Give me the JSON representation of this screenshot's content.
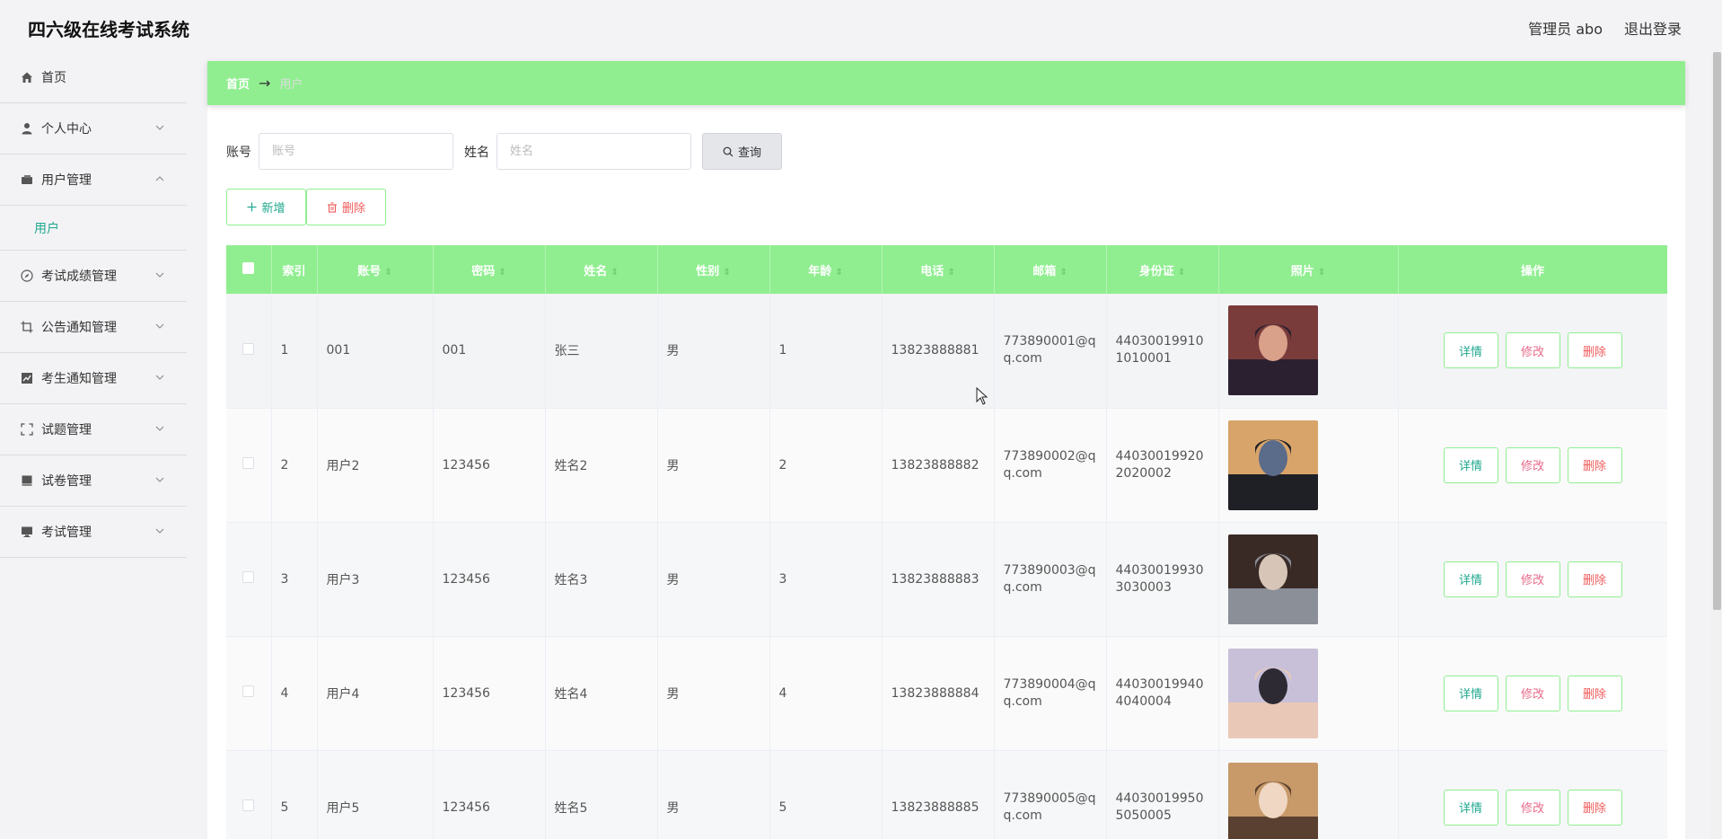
{
  "header": {
    "app_title": "四六级在线考试系统",
    "user_label": "管理员 abo",
    "logout_label": "退出登录"
  },
  "sidebar": {
    "items": [
      {
        "label": "首页",
        "icon": "home-icon"
      },
      {
        "label": "个人中心",
        "icon": "user-icon"
      },
      {
        "label": "用户管理",
        "icon": "wallet-icon",
        "expanded": true
      },
      {
        "label": "考试成绩管理",
        "icon": "compass-icon"
      },
      {
        "label": "公告通知管理",
        "icon": "crop-icon"
      },
      {
        "label": "考生通知管理",
        "icon": "chart-icon"
      },
      {
        "label": "试题管理",
        "icon": "fullscreen-icon"
      },
      {
        "label": "试卷管理",
        "icon": "notebook-icon"
      },
      {
        "label": "考试管理",
        "icon": "monitor-icon"
      }
    ],
    "submenu_active": "用户"
  },
  "breadcrumb": {
    "home": "首页",
    "arrow": "→",
    "current": "用户"
  },
  "search": {
    "account_label": "账号",
    "account_placeholder": "账号",
    "account_value": "",
    "name_label": "姓名",
    "name_placeholder": "姓名",
    "name_value": "",
    "query_label": "查询"
  },
  "actions": {
    "add_label": "新增",
    "delete_label": "删除"
  },
  "table": {
    "columns": [
      "索引",
      "账号",
      "密码",
      "姓名",
      "性别",
      "年龄",
      "电话",
      "邮箱",
      "身份证",
      "照片",
      "操作"
    ],
    "op_labels": {
      "detail": "详情",
      "edit": "修改",
      "remove": "删除"
    },
    "rows": [
      {
        "index": "1",
        "account": "001",
        "password": "001",
        "name": "张三",
        "gender": "男",
        "age": "1",
        "phone": "13823888881",
        "email": "773890001@qq.com",
        "id_card": "440300199101010001",
        "photo_colors": [
          "#7a3b3b",
          "#d9a08a",
          "#2a2030"
        ]
      },
      {
        "index": "2",
        "account": "用户2",
        "password": "123456",
        "name": "姓名2",
        "gender": "男",
        "age": "2",
        "phone": "13823888882",
        "email": "773890002@qq.com",
        "id_card": "440300199202020002",
        "photo_colors": [
          "#d8a46a",
          "#5b6b8a",
          "#1f1f26"
        ]
      },
      {
        "index": "3",
        "account": "用户3",
        "password": "123456",
        "name": "姓名3",
        "gender": "男",
        "age": "3",
        "phone": "13823888883",
        "email": "773890003@qq.com",
        "id_card": "440300199303030003",
        "photo_colors": [
          "#3a2a26",
          "#d7c6b8",
          "#8a8f98"
        ]
      },
      {
        "index": "4",
        "account": "用户4",
        "password": "123456",
        "name": "姓名4",
        "gender": "男",
        "age": "4",
        "phone": "13823888884",
        "email": "773890004@qq.com",
        "id_card": "440300199404040004",
        "photo_colors": [
          "#c8c0d8",
          "#2d2a33",
          "#e9c8b8"
        ]
      },
      {
        "index": "5",
        "account": "用户5",
        "password": "123456",
        "name": "姓名5",
        "gender": "男",
        "age": "5",
        "phone": "13823888885",
        "email": "773890005@qq.com",
        "id_card": "440300199505050005",
        "photo_colors": [
          "#c89a6a",
          "#efd7c3",
          "#5a4030"
        ]
      }
    ]
  },
  "colors": {
    "accent_green": "#90ee90",
    "teal_text": "#1fa88e",
    "danger_text": "#f05a5a",
    "edit_text": "#e86a8a"
  }
}
